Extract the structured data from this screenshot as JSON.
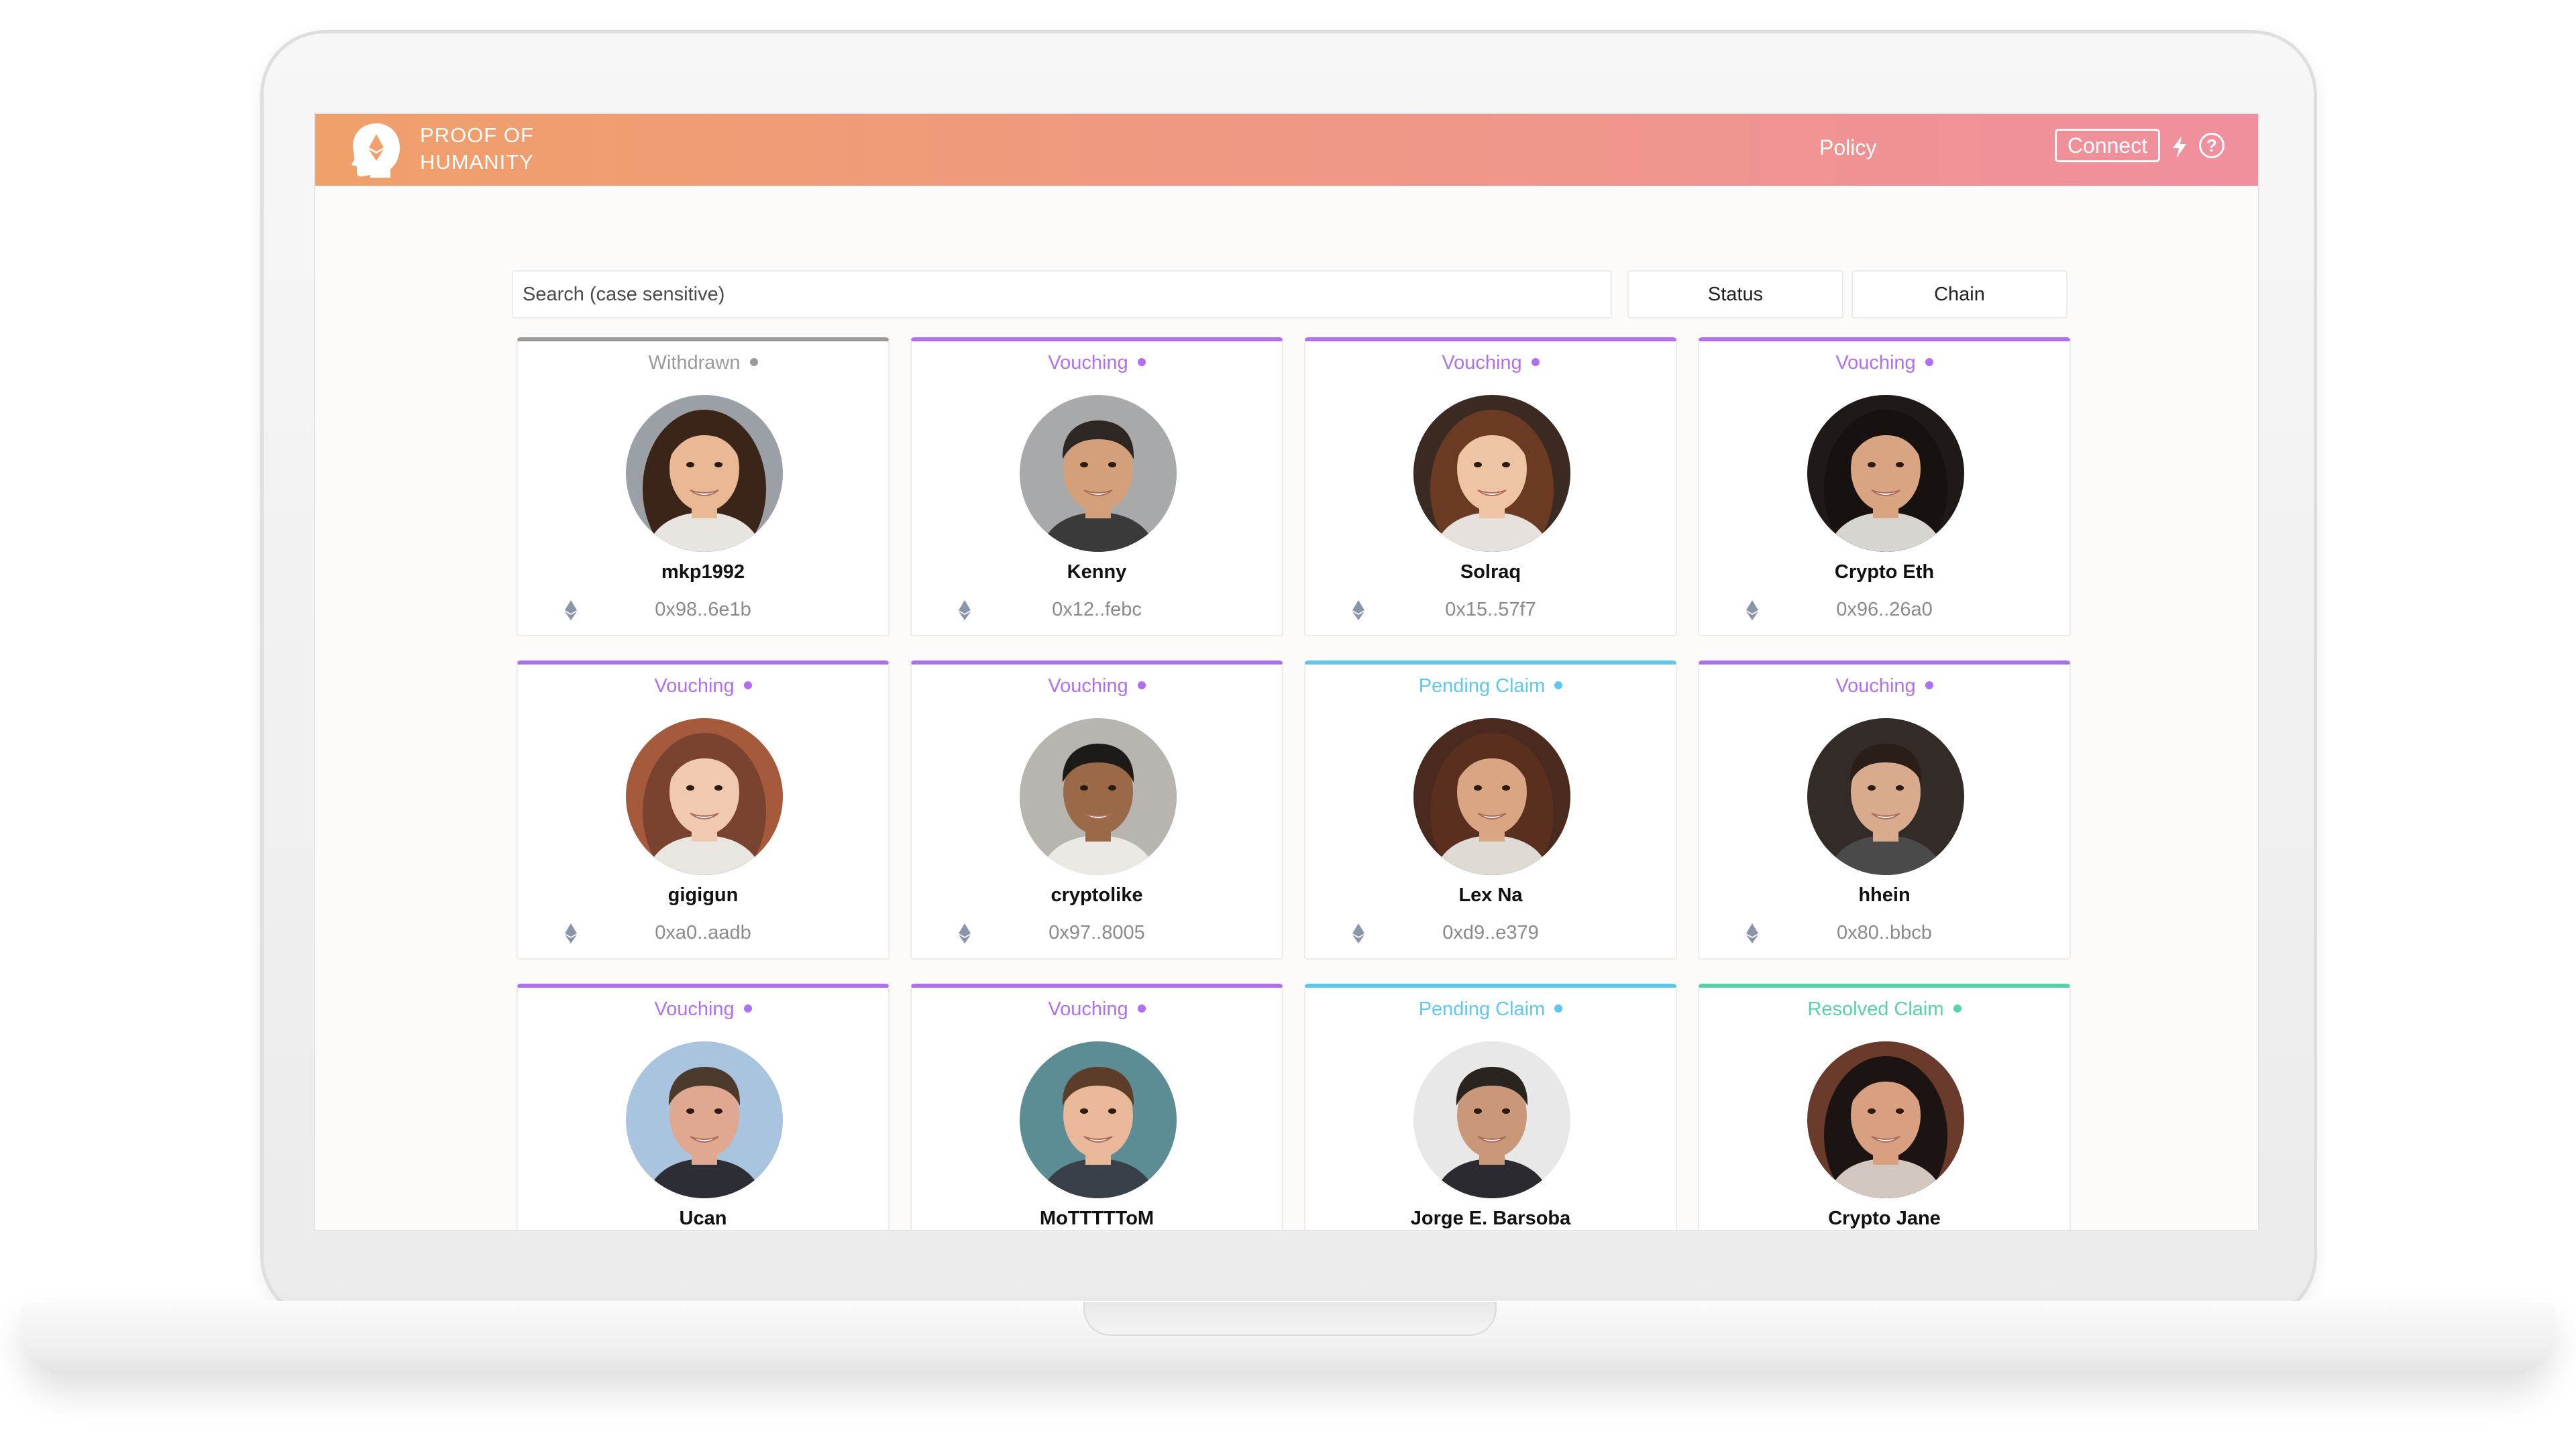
{
  "header": {
    "brand_line1": "PROOF OF",
    "brand_line2": "HUMANITY",
    "nav_policy": "Policy",
    "connect_label": "Connect",
    "help_glyph": "?",
    "gradient_start": "#f0a06a",
    "gradient_end": "#f08f9e"
  },
  "search": {
    "placeholder": "Search (case sensitive)"
  },
  "filters": {
    "status_label": "Status",
    "chain_label": "Chain"
  },
  "status_colors": {
    "Withdrawn": "#9a9a9a",
    "Vouching": "#b06ff0",
    "Pending Claim": "#5cc8f0",
    "Resolved Claim": "#56d2a8"
  },
  "profiles": [
    {
      "status": "Withdrawn",
      "name": "mkp1992",
      "address": "0x98..6e1b",
      "avatar": {
        "bg": "#9aa0a6",
        "hair": "#3b2418",
        "skin": "#e9b894",
        "shirt": "#e8e4e0",
        "hair_style": "long"
      }
    },
    {
      "status": "Vouching",
      "name": "Kenny",
      "address": "0x12..febc",
      "avatar": {
        "bg": "#a8a9ab",
        "hair": "#2d2622",
        "skin": "#d4a07a",
        "shirt": "#3a3a3a",
        "hair_style": "short"
      }
    },
    {
      "status": "Vouching",
      "name": "Solraq",
      "address": "0x15..57f7",
      "avatar": {
        "bg": "#3b2a22",
        "hair": "#6a3b22",
        "skin": "#efc4a4",
        "shirt": "#e6e1dc",
        "hair_style": "long"
      }
    },
    {
      "status": "Vouching",
      "name": "Crypto Eth",
      "address": "0x96..26a0",
      "avatar": {
        "bg": "#1f1a18",
        "hair": "#171210",
        "skin": "#d9a482",
        "shirt": "#d8d4d0",
        "hair_style": "long"
      }
    },
    {
      "status": "Vouching",
      "name": "gigigun",
      "address": "0xa0..aadb",
      "avatar": {
        "bg": "#a55a3c",
        "hair": "#7a4330",
        "skin": "#f0c9b0",
        "shirt": "#e9e5e0",
        "hair_style": "long"
      }
    },
    {
      "status": "Vouching",
      "name": "cryptolike",
      "address": "0x97..8005",
      "avatar": {
        "bg": "#b8b4b0",
        "hair": "#1e1a18",
        "skin": "#9a6a48",
        "shirt": "#ece8e4",
        "hair_style": "short"
      }
    },
    {
      "status": "Pending Claim",
      "name": "Lex Na",
      "address": "0xd9..e379",
      "avatar": {
        "bg": "#4a2a1e",
        "hair": "#5a2f1e",
        "skin": "#d9a582",
        "shirt": "#e0dad4",
        "hair_style": "long"
      }
    },
    {
      "status": "Vouching",
      "name": "hhein",
      "address": "0x80..bbcb",
      "avatar": {
        "bg": "#332b28",
        "hair": "#2a1e18",
        "skin": "#d8ab8c",
        "shirt": "#4a4a4a",
        "hair_style": "short"
      }
    },
    {
      "status": "Vouching",
      "name": "Ucan",
      "address": "",
      "avatar": {
        "bg": "#a9c4de",
        "hair": "#4c3a2c",
        "skin": "#e0a890",
        "shirt": "#2b2f35",
        "hair_style": "short"
      }
    },
    {
      "status": "Vouching",
      "name": "MoTTTTToM",
      "address": "",
      "avatar": {
        "bg": "#5c8c94",
        "hair": "#5c3e28",
        "skin": "#e8b898",
        "shirt": "#3a4048",
        "hair_style": "short"
      }
    },
    {
      "status": "Pending Claim",
      "name": "Jorge E. Barsoba",
      "address": "",
      "avatar": {
        "bg": "#e8e8e8",
        "hair": "#2a2420",
        "skin": "#c89878",
        "shirt": "#2a2a30",
        "hair_style": "short"
      }
    },
    {
      "status": "Resolved Claim",
      "name": "Crypto Jane",
      "address": "",
      "avatar": {
        "bg": "#6a3a2a",
        "hair": "#1c1412",
        "skin": "#d8a080",
        "shirt": "#d2c8c0",
        "hair_style": "long"
      }
    }
  ]
}
